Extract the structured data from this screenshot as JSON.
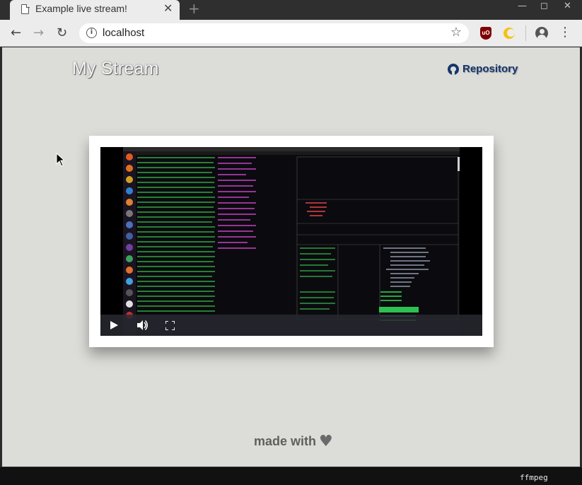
{
  "browser": {
    "tab_title": "Example live stream!",
    "tab_close": "✕",
    "new_tab": "+",
    "url": "localhost",
    "minimize": "—",
    "maximize": "◻",
    "close": "✕",
    "extensions": [
      "ublock-origin-icon",
      "dark-reader-icon"
    ],
    "ublock_label": "uO"
  },
  "page": {
    "site_title": "My Stream",
    "repo_link_label": "Repository",
    "footer_text": "made with",
    "colors": {
      "background": "#dcdcd8",
      "repo_link": "#15356b",
      "footer": "#5f5f5f"
    }
  },
  "video": {
    "controls": [
      "play-icon",
      "volume-icon",
      "fullscreen-icon"
    ]
  },
  "terminal": {
    "label": "ffmpeg"
  }
}
